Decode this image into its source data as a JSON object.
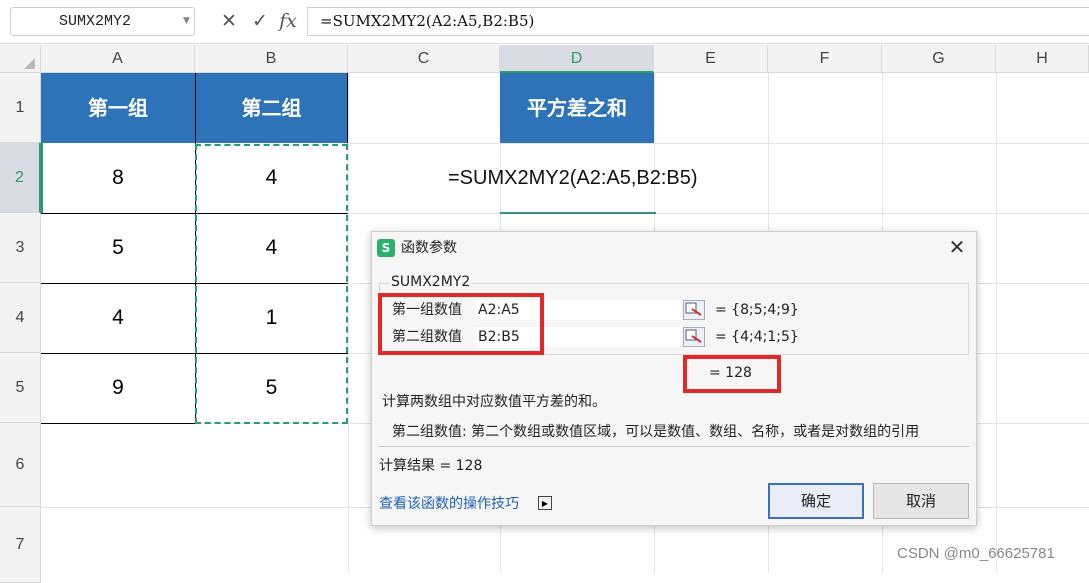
{
  "formula_bar": {
    "name_box": "SUMX2MY2",
    "cancel_icon": "✕",
    "confirm_icon": "✓",
    "fx_icon": "fx",
    "formula": "=SUMX2MY2(A2:A5,B2:B5)"
  },
  "columns": [
    "A",
    "B",
    "C",
    "D",
    "E",
    "F",
    "G",
    "H"
  ],
  "rows": [
    "1",
    "2",
    "3",
    "4",
    "5",
    "6",
    "7"
  ],
  "table": {
    "headers": [
      "第一组",
      "第二组"
    ],
    "group1": [
      "8",
      "5",
      "4",
      "9"
    ],
    "group2": [
      "4",
      "4",
      "1",
      "5"
    ]
  },
  "d1_label": "平方差之和",
  "cell_formula": "=SUMX2MY2(A2:A5,B2:B5)",
  "dialog": {
    "title": "函数参数",
    "app_icon": "S",
    "function_name": "SUMX2MY2",
    "args": [
      {
        "label": "第一组数值",
        "value": "A2:A5",
        "result": "= {8;5;4;9}"
      },
      {
        "label": "第二组数值",
        "value": "B2:B5",
        "result": "= {4;4;1;5}"
      }
    ],
    "formula_result": "= 128",
    "description": "计算两数组中对应数值平方差的和。",
    "arg_help": "第二组数值:  第二个数组或数值区域，可以是数值、数组、名称，或者是对数组的引用",
    "calc_result": "计算结果  =  128",
    "help_link": "查看该函数的操作技巧",
    "ok_label": "确定",
    "cancel_label": "取消"
  },
  "watermark": "CSDN @m0_66625781",
  "colors": {
    "header_fill": "#2e72b8",
    "accent": "#2d9a6b",
    "highlight": "#e02a2a",
    "link": "#1f5fb8"
  }
}
